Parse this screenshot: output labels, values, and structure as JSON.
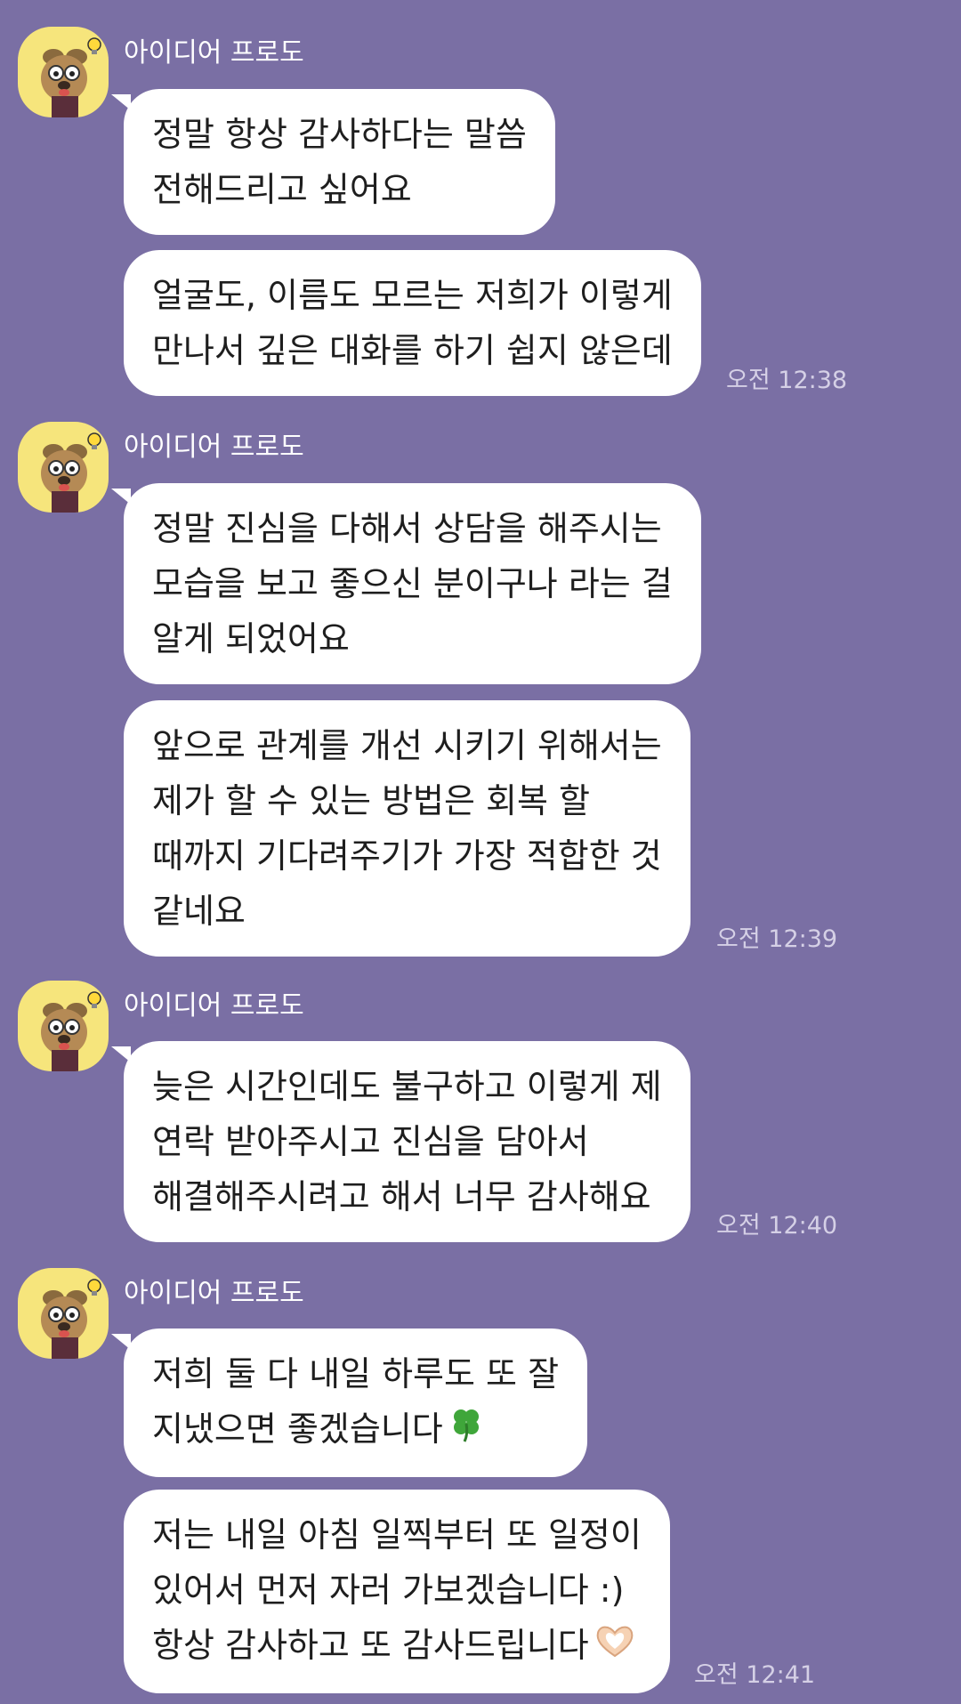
{
  "colors": {
    "background": "#7a6fa4",
    "bubble": "#ffffff",
    "avatar_bg": "#f6e57c",
    "timestamp": "#d5d0e6"
  },
  "groups": [
    {
      "sender": "아이디어 프로도",
      "avatar_icon": "frodo-dog-avatar-icon",
      "messages": [
        {
          "lines": [
            "정말 항상 감사하다는 말씀",
            "전해드리고 싶어요"
          ]
        },
        {
          "lines": [
            "얼굴도, 이름도 모르는 저희가 이렇게",
            "만나서 깊은 대화를 하기 쉽지 않은데"
          ]
        }
      ],
      "time": "오전 12:38"
    },
    {
      "sender": "아이디어 프로도",
      "avatar_icon": "frodo-dog-avatar-icon",
      "messages": [
        {
          "lines": [
            "정말 진심을 다해서 상담을 해주시는",
            "모습을 보고 좋으신 분이구나 라는 걸",
            "알게 되었어요"
          ]
        },
        {
          "lines": [
            "앞으로 관계를 개선 시키기 위해서는",
            "제가 할 수 있는 방법은 회복 할",
            "때까지 기다려주기가 가장 적합한 것",
            "같네요"
          ]
        }
      ],
      "time": "오전 12:39"
    },
    {
      "sender": "아이디어 프로도",
      "avatar_icon": "frodo-dog-avatar-icon",
      "messages": [
        {
          "lines": [
            "늦은 시간인데도 불구하고 이렇게 제",
            "연락 받아주시고 진심을 담아서",
            "해결해주시려고 해서 너무 감사해요"
          ]
        }
      ],
      "time": "오전 12:40"
    },
    {
      "sender": "아이디어 프로도",
      "avatar_icon": "frodo-dog-avatar-icon",
      "messages": [
        {
          "lines": [
            "저희 둘 다 내일 하루도 또 잘",
            "지냈으면 좋겠습니다"
          ],
          "trailing_icon": "four-leaf-clover-icon"
        },
        {
          "lines": [
            "저는 내일 아침 일찍부터 또 일정이",
            "있어서 먼저 자러 가보겠습니다 :)",
            "항상 감사하고 또 감사드립니다"
          ],
          "trailing_icon": "heart-hands-icon"
        }
      ],
      "time": "오전 12:41"
    }
  ]
}
